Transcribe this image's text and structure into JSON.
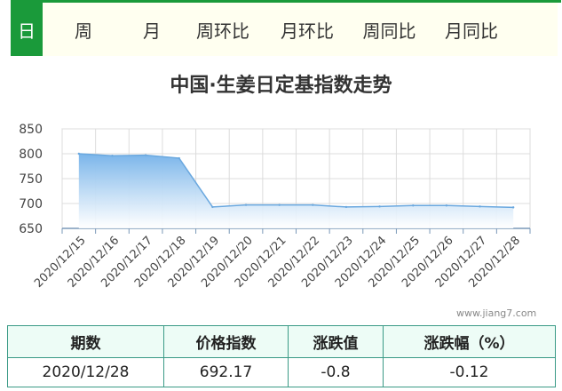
{
  "tabs": [
    "日",
    "周",
    "月",
    "周环比",
    "月环比",
    "周同比",
    "月同比"
  ],
  "active_tab": 0,
  "title": "中国·生姜日定基指数走势",
  "watermark": "www.jiang7.com",
  "colors": {
    "accent": "#1a9a3a",
    "line": "#7fb6e6",
    "area_top": "#7ab5ea",
    "table_border": "#3a9a86",
    "table_header_bg": "#edfcf6"
  },
  "chart_data": {
    "type": "area",
    "title": "中国·生姜日定基指数走势",
    "x": [
      "2020/12/15",
      "2020/12/16",
      "2020/12/17",
      "2020/12/18",
      "2020/12/19",
      "2020/12/20",
      "2020/12/21",
      "2020/12/22",
      "2020/12/23",
      "2020/12/24",
      "2020/12/25",
      "2020/12/26",
      "2020/12/27",
      "2020/12/28"
    ],
    "values": [
      800,
      796,
      797,
      791,
      693,
      697,
      697,
      697,
      693,
      694,
      696,
      696,
      694,
      692.17
    ],
    "yticks": [
      650,
      700,
      750,
      800,
      850
    ],
    "ylim": [
      650,
      850
    ],
    "grid": true
  },
  "table": {
    "headers": [
      "期数",
      "价格指数",
      "涨跌值",
      "涨跌幅（%）"
    ],
    "rows": [
      [
        "2020/12/28",
        "692.17",
        "-0.8",
        "-0.12"
      ]
    ]
  }
}
